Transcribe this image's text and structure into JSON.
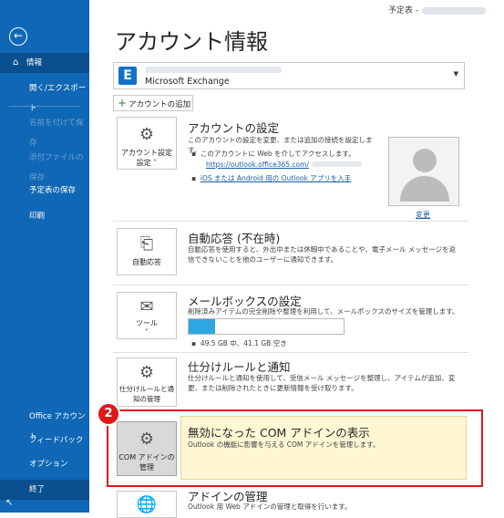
{
  "window": {
    "title": "予定表 -"
  },
  "sidebar": {
    "back": "←",
    "items": [
      {
        "label": "情報",
        "active": true
      },
      {
        "label": "開く/エクスポート"
      },
      {
        "label": "名前を付けて保存",
        "disabled": true
      },
      {
        "label": "添付ファイルの保存",
        "disabled": true
      },
      {
        "label": "予定表の保存"
      },
      {
        "label": "印刷"
      }
    ],
    "bottom_items": [
      {
        "label": "Office アカウント"
      },
      {
        "label": "フィードバック"
      },
      {
        "label": "オプション"
      },
      {
        "label": "終了"
      }
    ]
  },
  "main": {
    "title": "アカウント情報",
    "account": {
      "type": "Microsoft Exchange",
      "logo": "E"
    },
    "add_account": "アカウントの追加",
    "sections": {
      "account_settings": {
        "button": "アカウント設定",
        "button_sub": "設定 ˅",
        "title": "アカウントの設定",
        "desc": "このアカウントの設定を変更、または追加の接続を設定します。",
        "bullet1": "このアカウントに Web を介してアクセスします。",
        "link1": "https://outlook.office365.com/",
        "link2": "iOS または Android 用の Outlook アプリを入手",
        "change": "変更"
      },
      "auto_reply": {
        "button": "自動応答",
        "title": "自動応答 (不在時)",
        "desc": "自動応答を使用すると、外出中または休暇中であることや、電子メール メッセージを返信できないことを他のユーザーに通知できます。"
      },
      "mailbox": {
        "button": "ツール",
        "button_sub": "˅",
        "title": "メールボックスの設定",
        "desc": "削除済みアイテムの完全削除や整理を利用して、メールボックスのサイズを管理します。",
        "usage": "49.5 GB 中、41.1 GB 空き",
        "used_fraction": 0.17
      },
      "rules": {
        "button": "仕分けルールと通知の管理",
        "title": "仕分けルールと通知",
        "desc": "仕分けルールと通知を使用して、受信メール メッセージを整理し、アイテムが追加、変更、または削除されたときに更新情報を受け取ります。"
      },
      "com_addins": {
        "button": "COM アドインの管理",
        "title": "無効になった COM アドインの表示",
        "desc": "Outlook の機能に影響を与える COM アドインを管理します。"
      },
      "addins": {
        "title": "アドインの管理",
        "desc": "Outlook 用 Web アドインの管理と取得を行います。"
      }
    },
    "annotation_badge": "2"
  },
  "colors": {
    "sidebar": "#0f67b5",
    "highlight": "#e01818",
    "yellow": "#fff7d4"
  }
}
